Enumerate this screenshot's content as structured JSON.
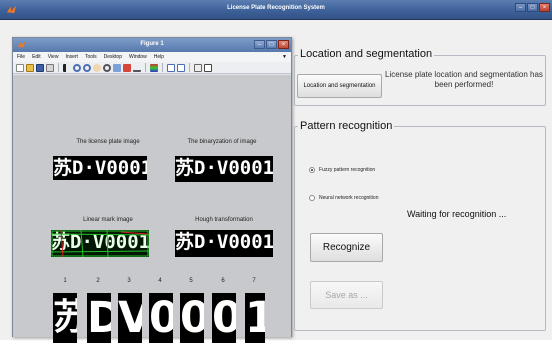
{
  "app": {
    "title": "License Plate Recognition System",
    "window_buttons": [
      "minimize",
      "maximize",
      "close"
    ]
  },
  "figure": {
    "title": "Figure 1",
    "menu": [
      "File",
      "Edit",
      "View",
      "Insert",
      "Tools",
      "Desktop",
      "Window",
      "Help"
    ],
    "toolbar_icons": [
      "new-icon",
      "open-icon",
      "save-icon",
      "print-icon",
      "pointer-icon",
      "zoom-in-icon",
      "zoom-out-icon",
      "pan-icon",
      "rotate-icon",
      "data-cursor-icon",
      "brush-icon",
      "link-icon",
      "colorbar-icon",
      "legend-icon",
      "hide-tools-icon",
      "show-tools-icon"
    ],
    "subplots": {
      "license_plate": {
        "title": "The license plate image",
        "text": "苏D·V0001"
      },
      "binaryzation": {
        "title": "The binaryzation of image",
        "text": "苏D·V0001"
      },
      "linear_mark": {
        "title": "Linear mark image",
        "text": "苏D·V0001"
      },
      "hough": {
        "title": "Hough transformation",
        "text": "苏D·V0001"
      }
    },
    "char_labels": [
      "1",
      "2",
      "3",
      "4",
      "5",
      "6",
      "7"
    ],
    "chars": [
      "苏",
      "D",
      "V",
      "0",
      "0",
      "0",
      "1"
    ]
  },
  "location": {
    "group_label": "Location and segmentation",
    "button_label": "Location and segmentation",
    "status": "License plate location and segmentation has been performed!"
  },
  "pattern": {
    "group_label": "Pattern recognition",
    "options": [
      {
        "label": "Fuzzy pattern recognition",
        "selected": true
      },
      {
        "label": "Neural network recognition",
        "selected": false
      }
    ],
    "status": "Waiting for recognition ...",
    "recognize_label": "Recognize",
    "save_label": "Save as ..."
  },
  "colors": {
    "titlebar": "#3d6199",
    "panel": "#f0f0f0",
    "figure_bg": "#c7c9cc",
    "linear_mark": "#22c12b",
    "linear_mark_red": "#e02020"
  }
}
